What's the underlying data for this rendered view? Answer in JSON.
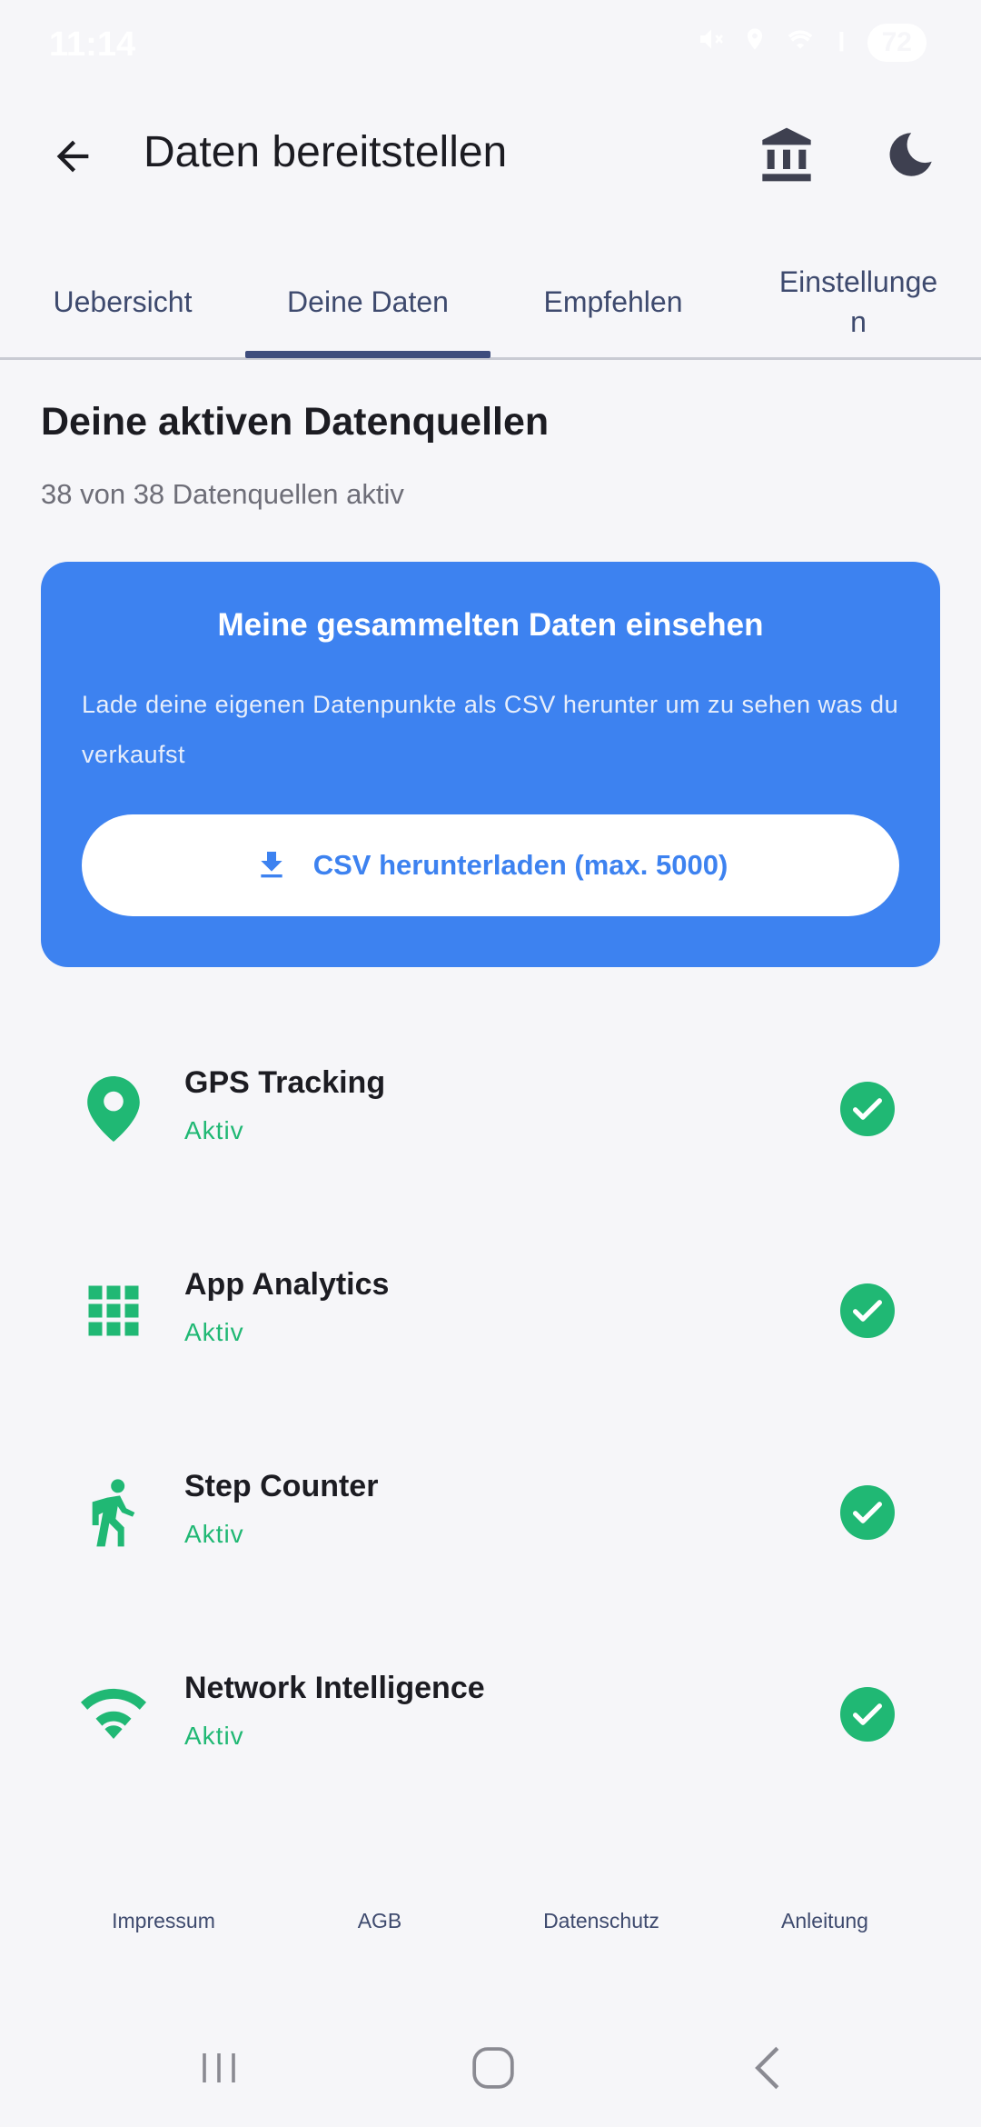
{
  "status_bar": {
    "time": "11:14",
    "battery": "72"
  },
  "app_bar": {
    "title": "Daten bereitstellen"
  },
  "tabs": [
    {
      "label": "Uebersicht",
      "active": false
    },
    {
      "label": "Deine Daten",
      "active": true
    },
    {
      "label": "Empfehlen",
      "active": false
    },
    {
      "label": "Einstellunge\nn",
      "active": false
    }
  ],
  "section": {
    "title": "Deine aktiven Datenquellen",
    "subtitle": "38 von 38 Datenquellen aktiv"
  },
  "card": {
    "title": "Meine gesammelten Daten einsehen",
    "description": "Lade deine eigenen Datenpunkte als CSV herunter um zu sehen was du verkaufst",
    "button_label": "CSV herunterladen (max. 5000)",
    "color": "#3D82F0"
  },
  "sources": [
    {
      "title": "GPS Tracking",
      "status": "Aktiv",
      "icon": "location-pin-icon"
    },
    {
      "title": "App Analytics",
      "status": "Aktiv",
      "icon": "grid-icon"
    },
    {
      "title": "Step Counter",
      "status": "Aktiv",
      "icon": "walking-icon"
    },
    {
      "title": "Network Intelligence",
      "status": "Aktiv",
      "icon": "wifi-icon"
    }
  ],
  "footer": {
    "links": [
      "Impressum",
      "AGB",
      "Datenschutz",
      "Anleitung"
    ]
  },
  "colors": {
    "accent_green": "#20B874",
    "tab_text": "#3E4A6E",
    "background": "#F6F6F9"
  }
}
